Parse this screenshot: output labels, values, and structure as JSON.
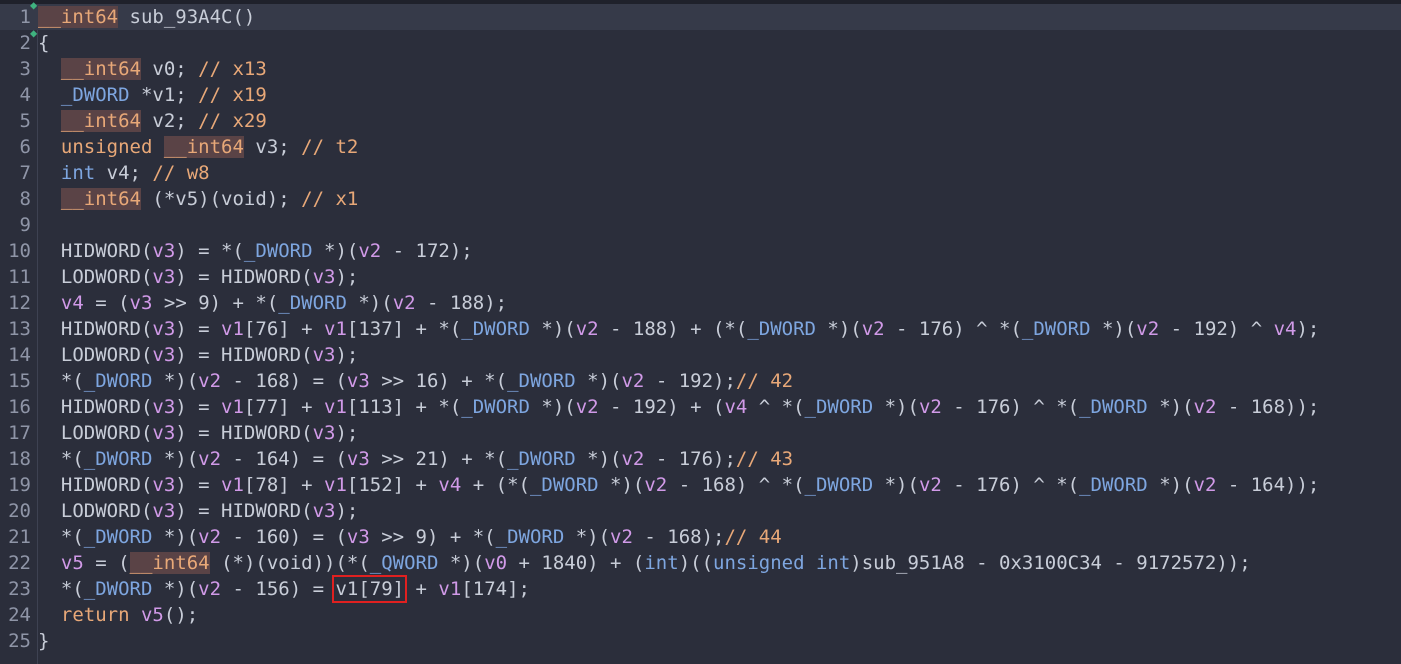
{
  "lines": [
    {
      "n": "1",
      "segs": [
        [
          "ty-hl",
          "__int64"
        ],
        [
          "pl",
          " sub_93A4C()"
        ]
      ]
    },
    {
      "n": "2",
      "segs": [
        [
          "pl",
          "{"
        ]
      ]
    },
    {
      "n": "3",
      "segs": [
        [
          "pl",
          "  "
        ],
        [
          "ty-hl",
          "__int64"
        ],
        [
          "pl",
          " v0; "
        ],
        [
          "cm",
          "// x13"
        ]
      ]
    },
    {
      "n": "4",
      "segs": [
        [
          "pl",
          "  "
        ],
        [
          "tyb",
          "_DWORD"
        ],
        [
          "pl",
          " *v1; "
        ],
        [
          "cm",
          "// x19"
        ]
      ]
    },
    {
      "n": "5",
      "segs": [
        [
          "pl",
          "  "
        ],
        [
          "ty-hl",
          "__int64"
        ],
        [
          "pl",
          " v2; "
        ],
        [
          "cm",
          "// x29"
        ]
      ]
    },
    {
      "n": "6",
      "segs": [
        [
          "pl",
          "  "
        ],
        [
          "kw",
          "unsigned"
        ],
        [
          "pl",
          " "
        ],
        [
          "ty-hl",
          "__int64"
        ],
        [
          "pl",
          " v3; "
        ],
        [
          "cm",
          "// t2"
        ]
      ]
    },
    {
      "n": "7",
      "segs": [
        [
          "pl",
          "  "
        ],
        [
          "tyb",
          "int"
        ],
        [
          "pl",
          " v4; "
        ],
        [
          "cm",
          "// w8"
        ]
      ]
    },
    {
      "n": "8",
      "segs": [
        [
          "pl",
          "  "
        ],
        [
          "ty-hl",
          "__int64"
        ],
        [
          "pl",
          " (*v5)(void); "
        ],
        [
          "cm",
          "// x1"
        ]
      ]
    },
    {
      "n": "9",
      "segs": []
    },
    {
      "n": "10",
      "segs": [
        [
          "pl",
          "  HIDWORD("
        ],
        [
          "vr2",
          "v3"
        ],
        [
          "pl",
          ") = *("
        ],
        [
          "tyb",
          "_DWORD"
        ],
        [
          "pl",
          " *)("
        ],
        [
          "vr2",
          "v2"
        ],
        [
          "pl",
          " - 172);"
        ]
      ]
    },
    {
      "n": "11",
      "segs": [
        [
          "pl",
          "  LODWORD("
        ],
        [
          "vr2",
          "v3"
        ],
        [
          "pl",
          ") = HIDWORD("
        ],
        [
          "vr2",
          "v3"
        ],
        [
          "pl",
          ");"
        ]
      ]
    },
    {
      "n": "12",
      "segs": [
        [
          "pl",
          "  "
        ],
        [
          "vr2",
          "v4"
        ],
        [
          "pl",
          " = ("
        ],
        [
          "vr2",
          "v3"
        ],
        [
          "pl",
          " >> 9) + *("
        ],
        [
          "tyb",
          "_DWORD"
        ],
        [
          "pl",
          " *)("
        ],
        [
          "vr2",
          "v2"
        ],
        [
          "pl",
          " - 188);"
        ]
      ]
    },
    {
      "n": "13",
      "segs": [
        [
          "pl",
          "  HIDWORD("
        ],
        [
          "vr2",
          "v3"
        ],
        [
          "pl",
          ") = "
        ],
        [
          "vr2",
          "v1"
        ],
        [
          "pl",
          "[76] + "
        ],
        [
          "vr2",
          "v1"
        ],
        [
          "pl",
          "[137] + *("
        ],
        [
          "tyb",
          "_DWORD"
        ],
        [
          "pl",
          " *)("
        ],
        [
          "vr2",
          "v2"
        ],
        [
          "pl",
          " - 188) + (*("
        ],
        [
          "tyb",
          "_DWORD"
        ],
        [
          "pl",
          " *)("
        ],
        [
          "vr2",
          "v2"
        ],
        [
          "pl",
          " - 176) ^ *("
        ],
        [
          "tyb",
          "_DWORD"
        ],
        [
          "pl",
          " *)("
        ],
        [
          "vr2",
          "v2"
        ],
        [
          "pl",
          " - 192) ^ "
        ],
        [
          "vr2",
          "v4"
        ],
        [
          "pl",
          ");"
        ]
      ]
    },
    {
      "n": "14",
      "segs": [
        [
          "pl",
          "  LODWORD("
        ],
        [
          "vr2",
          "v3"
        ],
        [
          "pl",
          ") = HIDWORD("
        ],
        [
          "vr2",
          "v3"
        ],
        [
          "pl",
          ");"
        ]
      ]
    },
    {
      "n": "15",
      "segs": [
        [
          "pl",
          "  *("
        ],
        [
          "tyb",
          "_DWORD"
        ],
        [
          "pl",
          " *)("
        ],
        [
          "vr2",
          "v2"
        ],
        [
          "pl",
          " - 168) = ("
        ],
        [
          "vr2",
          "v3"
        ],
        [
          "pl",
          " >> 16) + *("
        ],
        [
          "tyb",
          "_DWORD"
        ],
        [
          "pl",
          " *)("
        ],
        [
          "vr2",
          "v2"
        ],
        [
          "pl",
          " - 192);"
        ],
        [
          "cm",
          "// 42"
        ]
      ]
    },
    {
      "n": "16",
      "segs": [
        [
          "pl",
          "  HIDWORD("
        ],
        [
          "vr2",
          "v3"
        ],
        [
          "pl",
          ") = "
        ],
        [
          "vr2",
          "v1"
        ],
        [
          "pl",
          "[77] + "
        ],
        [
          "vr2",
          "v1"
        ],
        [
          "pl",
          "[113] + *("
        ],
        [
          "tyb",
          "_DWORD"
        ],
        [
          "pl",
          " *)("
        ],
        [
          "vr2",
          "v2"
        ],
        [
          "pl",
          " - 192) + ("
        ],
        [
          "vr2",
          "v4"
        ],
        [
          "pl",
          " ^ *("
        ],
        [
          "tyb",
          "_DWORD"
        ],
        [
          "pl",
          " *)("
        ],
        [
          "vr2",
          "v2"
        ],
        [
          "pl",
          " - 176) ^ *("
        ],
        [
          "tyb",
          "_DWORD"
        ],
        [
          "pl",
          " *)("
        ],
        [
          "vr2",
          "v2"
        ],
        [
          "pl",
          " - 168));"
        ]
      ]
    },
    {
      "n": "17",
      "segs": [
        [
          "pl",
          "  LODWORD("
        ],
        [
          "vr2",
          "v3"
        ],
        [
          "pl",
          ") = HIDWORD("
        ],
        [
          "vr2",
          "v3"
        ],
        [
          "pl",
          ");"
        ]
      ]
    },
    {
      "n": "18",
      "segs": [
        [
          "pl",
          "  *("
        ],
        [
          "tyb",
          "_DWORD"
        ],
        [
          "pl",
          " *)("
        ],
        [
          "vr2",
          "v2"
        ],
        [
          "pl",
          " - 164) = ("
        ],
        [
          "vr2",
          "v3"
        ],
        [
          "pl",
          " >> 21) + *("
        ],
        [
          "tyb",
          "_DWORD"
        ],
        [
          "pl",
          " *)("
        ],
        [
          "vr2",
          "v2"
        ],
        [
          "pl",
          " - 176);"
        ],
        [
          "cm",
          "// 43"
        ]
      ]
    },
    {
      "n": "19",
      "segs": [
        [
          "pl",
          "  HIDWORD("
        ],
        [
          "vr2",
          "v3"
        ],
        [
          "pl",
          ") = "
        ],
        [
          "vr2",
          "v1"
        ],
        [
          "pl",
          "[78] + "
        ],
        [
          "vr2",
          "v1"
        ],
        [
          "pl",
          "[152] + "
        ],
        [
          "vr2",
          "v4"
        ],
        [
          "pl",
          " + (*("
        ],
        [
          "tyb",
          "_DWORD"
        ],
        [
          "pl",
          " *)("
        ],
        [
          "vr2",
          "v2"
        ],
        [
          "pl",
          " - 168) ^ *("
        ],
        [
          "tyb",
          "_DWORD"
        ],
        [
          "pl",
          " *)("
        ],
        [
          "vr2",
          "v2"
        ],
        [
          "pl",
          " - 176) ^ *("
        ],
        [
          "tyb",
          "_DWORD"
        ],
        [
          "pl",
          " *)("
        ],
        [
          "vr2",
          "v2"
        ],
        [
          "pl",
          " - 164));"
        ]
      ]
    },
    {
      "n": "20",
      "segs": [
        [
          "pl",
          "  LODWORD("
        ],
        [
          "vr2",
          "v3"
        ],
        [
          "pl",
          ") = HIDWORD("
        ],
        [
          "vr2",
          "v3"
        ],
        [
          "pl",
          ");"
        ]
      ]
    },
    {
      "n": "21",
      "segs": [
        [
          "pl",
          "  *("
        ],
        [
          "tyb",
          "_DWORD"
        ],
        [
          "pl",
          " *)("
        ],
        [
          "vr2",
          "v2"
        ],
        [
          "pl",
          " - 160) = ("
        ],
        [
          "vr2",
          "v3"
        ],
        [
          "pl",
          " >> 9) + *("
        ],
        [
          "tyb",
          "_DWORD"
        ],
        [
          "pl",
          " *)("
        ],
        [
          "vr2",
          "v2"
        ],
        [
          "pl",
          " - 168);"
        ],
        [
          "cm",
          "// 44"
        ]
      ]
    },
    {
      "n": "22",
      "segs": [
        [
          "pl",
          "  "
        ],
        [
          "vr2",
          "v5"
        ],
        [
          "pl",
          " = ("
        ],
        [
          "ty-hl",
          "__int64"
        ],
        [
          "pl",
          " (*)(void))(*("
        ],
        [
          "tyb",
          "_QWORD"
        ],
        [
          "pl",
          " *)("
        ],
        [
          "vr2",
          "v0"
        ],
        [
          "pl",
          " + 1840) + ("
        ],
        [
          "tyb",
          "int"
        ],
        [
          "pl",
          ")(("
        ],
        [
          "tyb",
          "unsigned int"
        ],
        [
          "pl",
          ")sub_951A8 - 0x3100C34 - 9172572));"
        ]
      ]
    },
    {
      "n": "23",
      "segs": [
        [
          "pl",
          "  *("
        ],
        [
          "tyb",
          "_DWORD"
        ],
        [
          "pl",
          " *)("
        ],
        [
          "vr2",
          "v2"
        ],
        [
          "pl",
          " - 156) = "
        ],
        [
          "box",
          "v1[79]"
        ],
        [
          "pl",
          " + "
        ],
        [
          "vr2",
          "v1"
        ],
        [
          "pl",
          "[174];"
        ]
      ]
    },
    {
      "n": "24",
      "segs": [
        [
          "pl",
          "  "
        ],
        [
          "kw",
          "return"
        ],
        [
          "pl",
          " "
        ],
        [
          "vr2",
          "v5"
        ],
        [
          "pl",
          "();"
        ]
      ]
    },
    {
      "n": "25",
      "segs": [
        [
          "pl",
          "}"
        ]
      ]
    }
  ]
}
